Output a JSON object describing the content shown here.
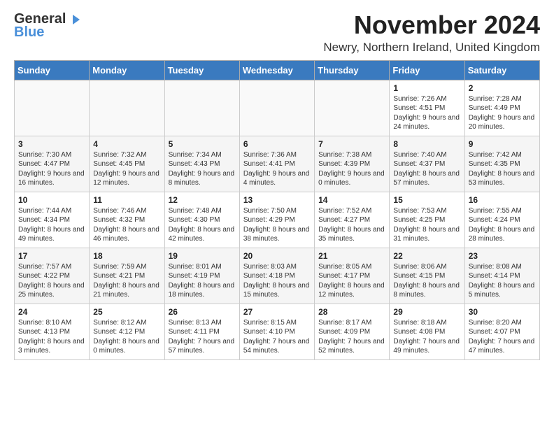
{
  "logo": {
    "line1": "General",
    "line2": "Blue"
  },
  "title": "November 2024",
  "location": "Newry, Northern Ireland, United Kingdom",
  "days_of_week": [
    "Sunday",
    "Monday",
    "Tuesday",
    "Wednesday",
    "Thursday",
    "Friday",
    "Saturday"
  ],
  "weeks": [
    [
      {
        "day": "",
        "content": ""
      },
      {
        "day": "",
        "content": ""
      },
      {
        "day": "",
        "content": ""
      },
      {
        "day": "",
        "content": ""
      },
      {
        "day": "",
        "content": ""
      },
      {
        "day": "1",
        "content": "Sunrise: 7:26 AM\nSunset: 4:51 PM\nDaylight: 9 hours and 24 minutes."
      },
      {
        "day": "2",
        "content": "Sunrise: 7:28 AM\nSunset: 4:49 PM\nDaylight: 9 hours and 20 minutes."
      }
    ],
    [
      {
        "day": "3",
        "content": "Sunrise: 7:30 AM\nSunset: 4:47 PM\nDaylight: 9 hours and 16 minutes."
      },
      {
        "day": "4",
        "content": "Sunrise: 7:32 AM\nSunset: 4:45 PM\nDaylight: 9 hours and 12 minutes."
      },
      {
        "day": "5",
        "content": "Sunrise: 7:34 AM\nSunset: 4:43 PM\nDaylight: 9 hours and 8 minutes."
      },
      {
        "day": "6",
        "content": "Sunrise: 7:36 AM\nSunset: 4:41 PM\nDaylight: 9 hours and 4 minutes."
      },
      {
        "day": "7",
        "content": "Sunrise: 7:38 AM\nSunset: 4:39 PM\nDaylight: 9 hours and 0 minutes."
      },
      {
        "day": "8",
        "content": "Sunrise: 7:40 AM\nSunset: 4:37 PM\nDaylight: 8 hours and 57 minutes."
      },
      {
        "day": "9",
        "content": "Sunrise: 7:42 AM\nSunset: 4:35 PM\nDaylight: 8 hours and 53 minutes."
      }
    ],
    [
      {
        "day": "10",
        "content": "Sunrise: 7:44 AM\nSunset: 4:34 PM\nDaylight: 8 hours and 49 minutes."
      },
      {
        "day": "11",
        "content": "Sunrise: 7:46 AM\nSunset: 4:32 PM\nDaylight: 8 hours and 46 minutes."
      },
      {
        "day": "12",
        "content": "Sunrise: 7:48 AM\nSunset: 4:30 PM\nDaylight: 8 hours and 42 minutes."
      },
      {
        "day": "13",
        "content": "Sunrise: 7:50 AM\nSunset: 4:29 PM\nDaylight: 8 hours and 38 minutes."
      },
      {
        "day": "14",
        "content": "Sunrise: 7:52 AM\nSunset: 4:27 PM\nDaylight: 8 hours and 35 minutes."
      },
      {
        "day": "15",
        "content": "Sunrise: 7:53 AM\nSunset: 4:25 PM\nDaylight: 8 hours and 31 minutes."
      },
      {
        "day": "16",
        "content": "Sunrise: 7:55 AM\nSunset: 4:24 PM\nDaylight: 8 hours and 28 minutes."
      }
    ],
    [
      {
        "day": "17",
        "content": "Sunrise: 7:57 AM\nSunset: 4:22 PM\nDaylight: 8 hours and 25 minutes."
      },
      {
        "day": "18",
        "content": "Sunrise: 7:59 AM\nSunset: 4:21 PM\nDaylight: 8 hours and 21 minutes."
      },
      {
        "day": "19",
        "content": "Sunrise: 8:01 AM\nSunset: 4:19 PM\nDaylight: 8 hours and 18 minutes."
      },
      {
        "day": "20",
        "content": "Sunrise: 8:03 AM\nSunset: 4:18 PM\nDaylight: 8 hours and 15 minutes."
      },
      {
        "day": "21",
        "content": "Sunrise: 8:05 AM\nSunset: 4:17 PM\nDaylight: 8 hours and 12 minutes."
      },
      {
        "day": "22",
        "content": "Sunrise: 8:06 AM\nSunset: 4:15 PM\nDaylight: 8 hours and 8 minutes."
      },
      {
        "day": "23",
        "content": "Sunrise: 8:08 AM\nSunset: 4:14 PM\nDaylight: 8 hours and 5 minutes."
      }
    ],
    [
      {
        "day": "24",
        "content": "Sunrise: 8:10 AM\nSunset: 4:13 PM\nDaylight: 8 hours and 3 minutes."
      },
      {
        "day": "25",
        "content": "Sunrise: 8:12 AM\nSunset: 4:12 PM\nDaylight: 8 hours and 0 minutes."
      },
      {
        "day": "26",
        "content": "Sunrise: 8:13 AM\nSunset: 4:11 PM\nDaylight: 7 hours and 57 minutes."
      },
      {
        "day": "27",
        "content": "Sunrise: 8:15 AM\nSunset: 4:10 PM\nDaylight: 7 hours and 54 minutes."
      },
      {
        "day": "28",
        "content": "Sunrise: 8:17 AM\nSunset: 4:09 PM\nDaylight: 7 hours and 52 minutes."
      },
      {
        "day": "29",
        "content": "Sunrise: 8:18 AM\nSunset: 4:08 PM\nDaylight: 7 hours and 49 minutes."
      },
      {
        "day": "30",
        "content": "Sunrise: 8:20 AM\nSunset: 4:07 PM\nDaylight: 7 hours and 47 minutes."
      }
    ]
  ]
}
